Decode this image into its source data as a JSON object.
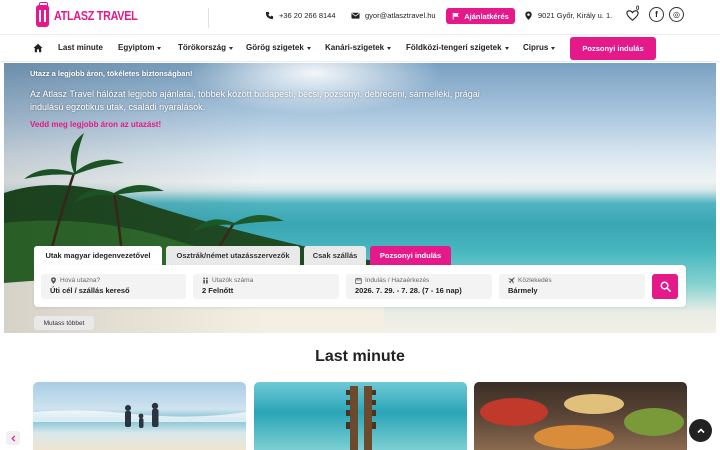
{
  "brand": {
    "name": "ATLASZ TRAVEL",
    "color": "#e5198a"
  },
  "topbar": {
    "phone": "+36 20 266 8144",
    "email": "gyor@atlasztravel.hu",
    "offer_button": "Ajánlatkérés",
    "address": "9021 Győr, Király u. 1.",
    "favorites_count": "0",
    "social": {
      "facebook": "f",
      "instagram": "◎"
    }
  },
  "nav": {
    "items": [
      {
        "label": "Last minute",
        "dropdown": false
      },
      {
        "label": "Egyiptom",
        "dropdown": true
      },
      {
        "label": "Törökország",
        "dropdown": true
      },
      {
        "label": "Görög szigetek",
        "dropdown": true
      },
      {
        "label": "Kanári-szigetek",
        "dropdown": true
      },
      {
        "label": "Földközi-tengeri szigetek",
        "dropdown": true
      },
      {
        "label": "Ciprus",
        "dropdown": true
      }
    ],
    "cta": "Pozsonyi indulás"
  },
  "hero": {
    "tagline": "Utazz a legjobb áron, tökéletes biztonságban!",
    "description": "Az Atlasz Travel hálózat legjobb ajánlatai, többek között budapesti, bécsi, pozsonyi, debreceni, sármelléki, prágai indulású egzotikus utak, családi nyaralások.",
    "link": "Vedd meg legjobb áron az utazást!"
  },
  "search": {
    "tabs": [
      "Utak magyar idegenvezetővel",
      "Osztrák/német utazásszervezők",
      "Csak szállás",
      "Pozsonyi indulás"
    ],
    "active_tab": 0,
    "fields": [
      {
        "label": "Hová utazna?",
        "value": "Úti cél / szállás kereső",
        "icon": "location-pin-icon"
      },
      {
        "label": "Utazók száma",
        "value": "2 Felnőtt",
        "icon": "travelers-icon"
      },
      {
        "label": "Indulás / Hazaérkezés",
        "value": "2026. 7. 29. - 7. 28. (7 - 16 nap)",
        "icon": "calendar-icon"
      },
      {
        "label": "Közlekedés",
        "value": "Bármely",
        "icon": "plane-icon"
      }
    ],
    "more_button": "Mutass többet"
  },
  "last_minute": {
    "title": "Last minute"
  }
}
